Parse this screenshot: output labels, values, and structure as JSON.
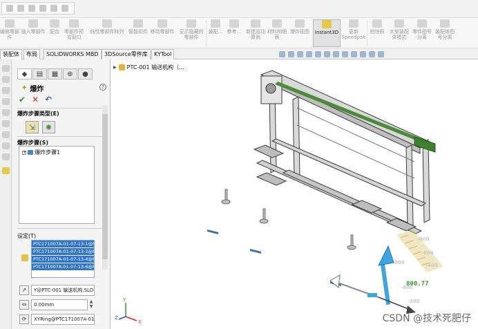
{
  "ribbon": {
    "buttons": [
      "编辑零部件",
      "插入零部件",
      "配合",
      "零部件预览窗口",
      "线性零部件阵列",
      "智能扣件",
      "移动零部件",
      "显示隐藏的零部件",
      "装配...",
      "参考...",
      "新建运动算例",
      "材料明细表",
      "爆炸视图",
      "Instant3D",
      "更新Speedpak",
      "拍快照",
      "大型装配体模式",
      "零件图号分离",
      "装配体图号分离"
    ],
    "active": "Instant3D"
  },
  "tabs": [
    "装配体",
    "布局",
    "SOLIDWORKS MBD",
    "3DSource零件库",
    "KYTool"
  ],
  "tree": {
    "root_label": "PTC-001 输送机构（..."
  },
  "property_manager": {
    "title": "爆炸",
    "help": "?",
    "ok": "✔",
    "cancel": "✕",
    "undo": "↶",
    "sections": {
      "step_type": "爆炸步骤类型(E)",
      "steps": "爆炸步骤(S)",
      "settings": "设定(T)"
    },
    "chevron": "⌃",
    "tree_expand": "+",
    "step_item": "爆炸步骤1",
    "selected_components": [
      "PTC171007A-01-07-13-1@P",
      "PTC171007A-01-07-13-2@P",
      "PTC171007A-01-07-13-4@P",
      "PTC171007A-01-07-13-6@P"
    ],
    "direction_field": "Y@PTC-001 输送机构.SLD...",
    "distance_field": "0.00mm",
    "rotation_field": "XYRing@PTC171007A-01-07"
  },
  "graphics": {
    "triad_readout": "800.77",
    "axis_y": "Y",
    "axis_z": "Z",
    "axis_x": "X",
    "watermark": "CSDN @技术死肥仔"
  },
  "colors": {
    "frame_stroke": "#3a3a3a",
    "belt": "#4a8c3a",
    "selection": "#3075c9",
    "triad_blue": "#3fa4e0",
    "ruler": "#e0c978"
  }
}
